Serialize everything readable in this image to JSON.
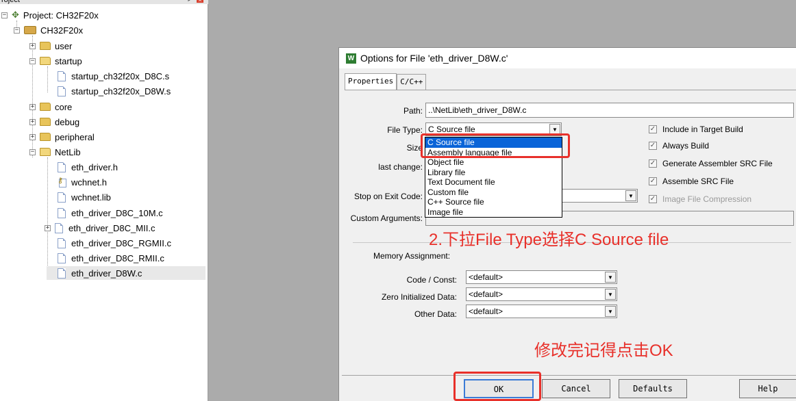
{
  "project_panel": {
    "title": "roject",
    "tree": [
      {
        "label": "Project: CH32F20x",
        "depth": 0,
        "expander": "minus",
        "icon": "project-icon"
      },
      {
        "label": "CH32F20x",
        "depth": 1,
        "expander": "minus",
        "icon": "target-icon"
      },
      {
        "label": "user",
        "depth": 2,
        "expander": "plus",
        "icon": "folder-icon"
      },
      {
        "label": "startup",
        "depth": 2,
        "expander": "minus",
        "icon": "folder-open-icon"
      },
      {
        "label": "startup_ch32f20x_D8C.s",
        "depth": 3,
        "icon": "file-icon"
      },
      {
        "label": "startup_ch32f20x_D8W.s",
        "depth": 3,
        "icon": "file-icon"
      },
      {
        "label": "core",
        "depth": 2,
        "expander": "plus",
        "icon": "folder-icon"
      },
      {
        "label": "debug",
        "depth": 2,
        "expander": "plus",
        "icon": "folder-icon"
      },
      {
        "label": "peripheral",
        "depth": 2,
        "expander": "plus",
        "icon": "folder-icon"
      },
      {
        "label": "NetLib",
        "depth": 2,
        "expander": "minus",
        "icon": "folder-open-icon"
      },
      {
        "label": "eth_driver.h",
        "depth": 3,
        "icon": "file-icon"
      },
      {
        "label": "wchnet.h",
        "depth": 3,
        "icon": "key-file-icon"
      },
      {
        "label": "wchnet.lib",
        "depth": 3,
        "icon": "file-icon"
      },
      {
        "label": "eth_driver_D8C_10M.c",
        "depth": 3,
        "icon": "file-icon"
      },
      {
        "label": "eth_driver_D8C_MII.c",
        "depth": 3,
        "expander": "plus",
        "icon": "file-icon"
      },
      {
        "label": "eth_driver_D8C_RGMII.c",
        "depth": 3,
        "icon": "file-icon"
      },
      {
        "label": "eth_driver_D8C_RMII.c",
        "depth": 3,
        "icon": "file-icon"
      },
      {
        "label": "eth_driver_D8W.c",
        "depth": 3,
        "icon": "file-icon",
        "selected": true
      }
    ]
  },
  "dialog": {
    "title": "Options for File 'eth_driver_D8W.c'",
    "tabs": [
      "Properties",
      "C/C++"
    ],
    "active_tab": "Properties",
    "path_label": "Path:",
    "path_value": "..\\NetLib\\eth_driver_D8W.c",
    "file_type_label": "File Type:",
    "file_type_value": "C Source file",
    "size_label": "Size",
    "last_change_label": "last change:",
    "stop_label": "Stop on Exit Code:",
    "custom_args_label": "Custom Arguments:",
    "file_type_options": [
      "C Source file",
      "Assembly language file",
      "Object file",
      "Library file",
      "Text Document file",
      "Custom file",
      "C++ Source file",
      "Image file"
    ],
    "selected_option_index": 0,
    "checkboxes": [
      {
        "label": "Include in Target Build",
        "checked": true,
        "enabled": true
      },
      {
        "label": "Always Build",
        "checked": true,
        "enabled": true
      },
      {
        "label": "Generate Assembler SRC File",
        "checked": true,
        "enabled": true
      },
      {
        "label": "Assemble SRC File",
        "checked": true,
        "enabled": true
      },
      {
        "label": "Image File Compression",
        "checked": true,
        "enabled": false
      }
    ],
    "memory": {
      "heading": "Memory Assignment:",
      "code_label": "Code / Const:",
      "code_value": "<default>",
      "zero_label": "Zero Initialized Data:",
      "zero_value": "<default>",
      "other_label": "Other Data:",
      "other_value": "<default>"
    },
    "buttons": {
      "ok": "OK",
      "cancel": "Cancel",
      "defaults": "Defaults",
      "help": "Help"
    }
  },
  "annotations": {
    "note1": "2.下拉File Type选择C Source file",
    "note2": "修改完记得点击OK",
    "color": "#e8302a"
  }
}
